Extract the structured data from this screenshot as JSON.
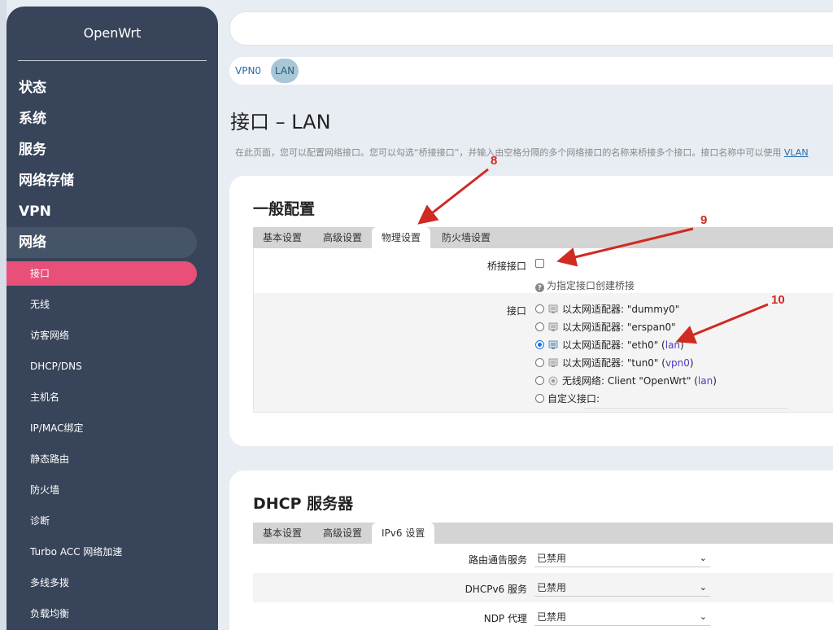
{
  "app": {
    "brand": "OpenWrt"
  },
  "sidebar": {
    "top_items": [
      {
        "label": "状态"
      },
      {
        "label": "系统"
      },
      {
        "label": "服务"
      },
      {
        "label": "网络存储"
      },
      {
        "label": "VPN"
      },
      {
        "label": "网络"
      }
    ],
    "sub_items": [
      {
        "label": "接口"
      },
      {
        "label": "无线"
      },
      {
        "label": "访客网络"
      },
      {
        "label": "DHCP/DNS"
      },
      {
        "label": "主机名"
      },
      {
        "label": "IP/MAC绑定"
      },
      {
        "label": "静态路由"
      },
      {
        "label": "防火墙"
      },
      {
        "label": "诊断"
      },
      {
        "label": "Turbo ACC 网络加速"
      },
      {
        "label": "多线多拨"
      },
      {
        "label": "负载均衡"
      }
    ]
  },
  "iface_tabs": [
    {
      "label": "VPN0"
    },
    {
      "label": "LAN"
    }
  ],
  "page": {
    "title": "接口 – LAN",
    "description": "在此页面，您可以配置网络接口。您可以勾选“桥接接口”，并输入由空格分隔的多个网络接口的名称来桥接多个接口。接口名称中可以使用 ",
    "description_link": "VLAN"
  },
  "general": {
    "title": "一般配置",
    "tabs": [
      {
        "label": "基本设置"
      },
      {
        "label": "高级设置"
      },
      {
        "label": "物理设置"
      },
      {
        "label": "防火墙设置"
      }
    ],
    "bridge_label": "桥接接口",
    "bridge_hint": "为指定接口创建桥接",
    "iface_label": "接口",
    "interfaces": [
      {
        "text": "以太网适配器: \"dummy0\"",
        "zone": ""
      },
      {
        "text": "以太网适配器: \"erspan0\"",
        "zone": ""
      },
      {
        "text": "以太网适配器: \"eth0\"",
        "zone": "lan"
      },
      {
        "text": "以太网适配器: \"tun0\"",
        "zone": "vpn0"
      },
      {
        "text": "无线网络: Client \"OpenWrt\"",
        "zone": "lan"
      },
      {
        "text": "自定义接口:",
        "zone": ""
      }
    ]
  },
  "dhcp": {
    "title": "DHCP 服务器",
    "tabs": [
      {
        "label": "基本设置"
      },
      {
        "label": "高级设置"
      },
      {
        "label": "IPv6 设置"
      }
    ],
    "rows": [
      {
        "label": "路由通告服务",
        "value": "已禁用"
      },
      {
        "label": "DHCPv6 服务",
        "value": "已禁用"
      },
      {
        "label": "NDP 代理",
        "value": "已禁用"
      }
    ]
  },
  "annotations": [
    {
      "num": "8"
    },
    {
      "num": "9"
    },
    {
      "num": "10"
    }
  ],
  "colors": {
    "sidebar_bg": "#374459",
    "active_item": "#e8507a",
    "annotation": "#d02a22",
    "link": "#2b6aa8"
  }
}
